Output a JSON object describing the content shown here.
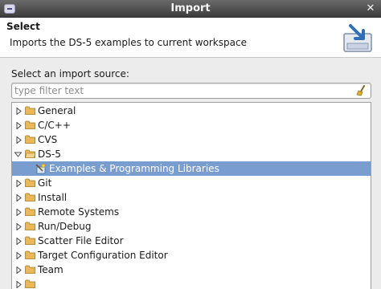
{
  "window": {
    "title": "Import"
  },
  "header": {
    "title": "Select",
    "description": "Imports the DS-5 examples to current workspace"
  },
  "source": {
    "label": "Select an import source:",
    "filter_placeholder": "type filter text",
    "filter_value": ""
  },
  "tree": {
    "items": [
      {
        "label": "General",
        "expanded": false
      },
      {
        "label": "C/C++",
        "expanded": false
      },
      {
        "label": "CVS",
        "expanded": false
      },
      {
        "label": "DS-5",
        "expanded": true
      },
      {
        "label": "Examples & Programming Libraries",
        "child": true,
        "selected": true
      },
      {
        "label": "Git",
        "expanded": false
      },
      {
        "label": "Install",
        "expanded": false
      },
      {
        "label": "Remote Systems",
        "expanded": false
      },
      {
        "label": "Run/Debug",
        "expanded": false
      },
      {
        "label": "Scatter File Editor",
        "expanded": false
      },
      {
        "label": "Target Configuration Editor",
        "expanded": false
      },
      {
        "label": "Team",
        "expanded": false
      }
    ]
  },
  "colors": {
    "selection": "#7a9dd0",
    "folder": "#e8b85a",
    "titlebar": "#4a4a4a"
  }
}
